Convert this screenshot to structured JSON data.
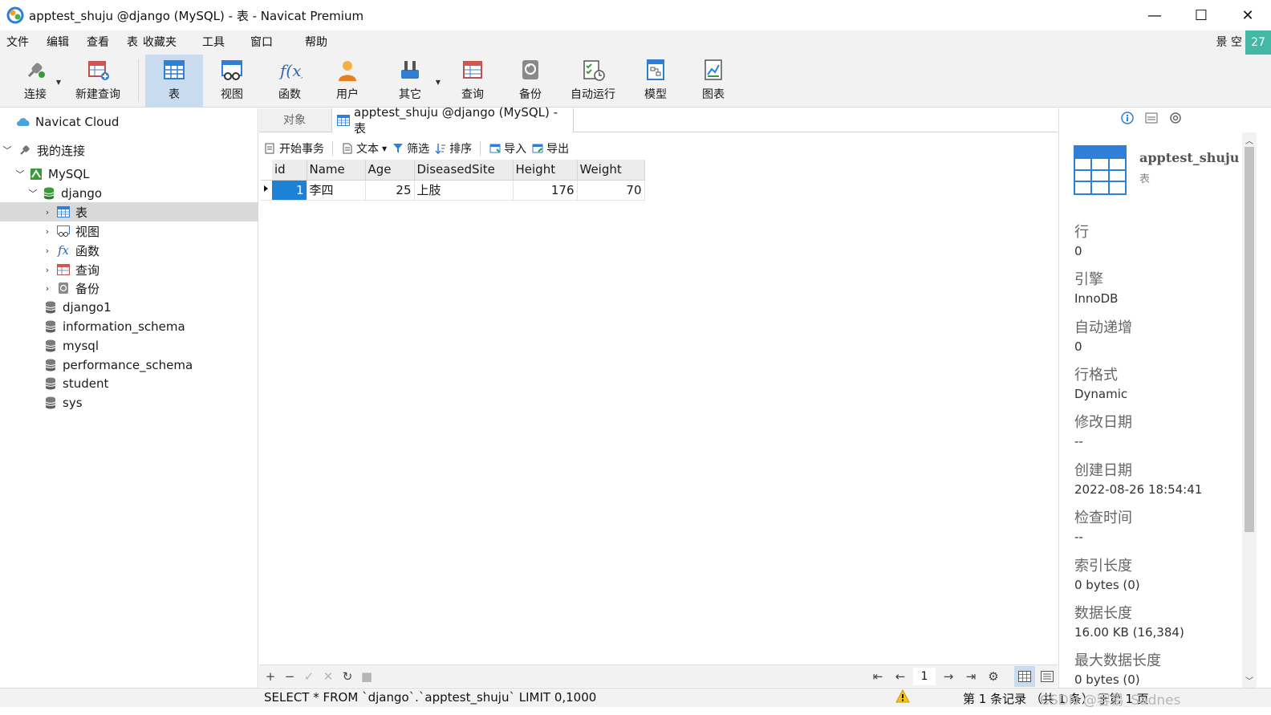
{
  "window": {
    "title": "apptest_shuju @django (MySQL) - 表 - Navicat Premium",
    "minimize": "—",
    "maximize": "☐",
    "close": "✕"
  },
  "menu": {
    "items": [
      "文件",
      "编辑",
      "查看",
      "表",
      "收藏夹",
      "工具",
      "窗口",
      "帮助"
    ],
    "right_label": "景 空",
    "badge": "27"
  },
  "toolbar": {
    "items": [
      "连接",
      "新建查询",
      "表",
      "视图",
      "函数",
      "用户",
      "其它",
      "查询",
      "备份",
      "自动运行",
      "模型",
      "图表"
    ],
    "active": "表"
  },
  "navigator": {
    "cloud": "Navicat Cloud",
    "my_connections": "我的连接",
    "connection": "MySQL",
    "database": "django",
    "children": [
      "表",
      "视图",
      "函数",
      "查询",
      "备份"
    ],
    "databases": [
      "django1",
      "information_schema",
      "mysql",
      "performance_schema",
      "student",
      "sys"
    ]
  },
  "tabs": {
    "objects": "对象",
    "active": "apptest_shuju @django (MySQL) - 表"
  },
  "grid_toolbar": {
    "begin_transaction": "开始事务",
    "text": "文本",
    "filter": "筛选",
    "sort": "排序",
    "import": "导入",
    "export": "导出"
  },
  "grid": {
    "columns": [
      "id",
      "Name",
      "Age",
      "DiseasedSite",
      "Height",
      "Weight"
    ],
    "rows": [
      [
        "1",
        "李四",
        "25",
        "上肢",
        "176",
        "70"
      ]
    ]
  },
  "gridbar": {
    "add": "+",
    "remove": "−",
    "apply": "✓",
    "discard": "✕",
    "refresh": "↻",
    "stop": "■",
    "first": "⇤",
    "prev": "←",
    "page": "1",
    "next": "→",
    "last": "⇥",
    "settings": "⚙"
  },
  "info_panel": {
    "name": "apptest_shuju",
    "type": "表",
    "props": [
      {
        "label": "行",
        "value": "0"
      },
      {
        "label": "引擎",
        "value": "InnoDB"
      },
      {
        "label": "自动递增",
        "value": "0"
      },
      {
        "label": "行格式",
        "value": "Dynamic"
      },
      {
        "label": "修改日期",
        "value": "--"
      },
      {
        "label": "创建日期",
        "value": "2022-08-26 18:54:41"
      },
      {
        "label": "检查时间",
        "value": "--"
      },
      {
        "label": "索引长度",
        "value": "0 bytes (0)"
      },
      {
        "label": "数据长度",
        "value": "16.00 KB (16,384)"
      },
      {
        "label": "最大数据长度",
        "value": "0 bytes (0)"
      }
    ]
  },
  "status": {
    "sql": "SELECT * FROM `django`.`apptest_shuju` LIMIT 0,1000",
    "records": "第 1 条记录 （共 1 条） 于第 1 页",
    "watermark": "CSDN @容易_Sadnes"
  },
  "colors": {
    "accent": "#1d82d6",
    "active_tool": "#c9dcef",
    "badge": "#43b8a5"
  }
}
